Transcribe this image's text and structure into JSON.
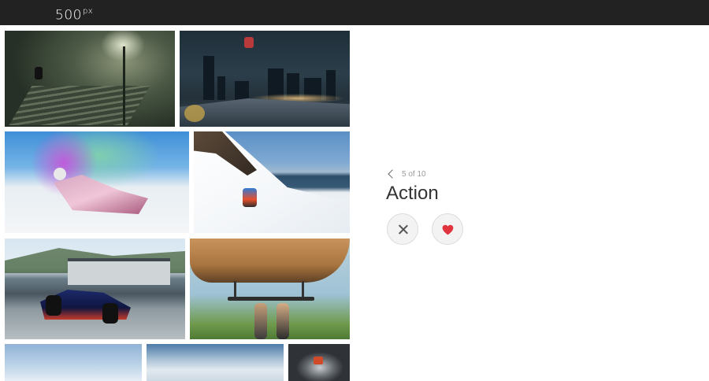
{
  "header": {
    "logo_text": "500",
    "logo_suffix": "px"
  },
  "gallery": {
    "photos": [
      {
        "name": "skateboarder on stairs"
      },
      {
        "name": "skier over city at night"
      },
      {
        "name": "skier with purple smoke"
      },
      {
        "name": "skier on steep slope"
      },
      {
        "name": "formula one car"
      },
      {
        "name": "men hanging from helicopter"
      },
      {
        "name": "sky"
      },
      {
        "name": "clouds"
      },
      {
        "name": "parachutist"
      }
    ]
  },
  "panel": {
    "counter": "5 of 10",
    "category": "Action",
    "buttons": {
      "dismiss": "close-icon",
      "like": "heart-icon"
    },
    "colors": {
      "heart": "#e0343f",
      "button_bg": "#f3f3f3"
    }
  }
}
